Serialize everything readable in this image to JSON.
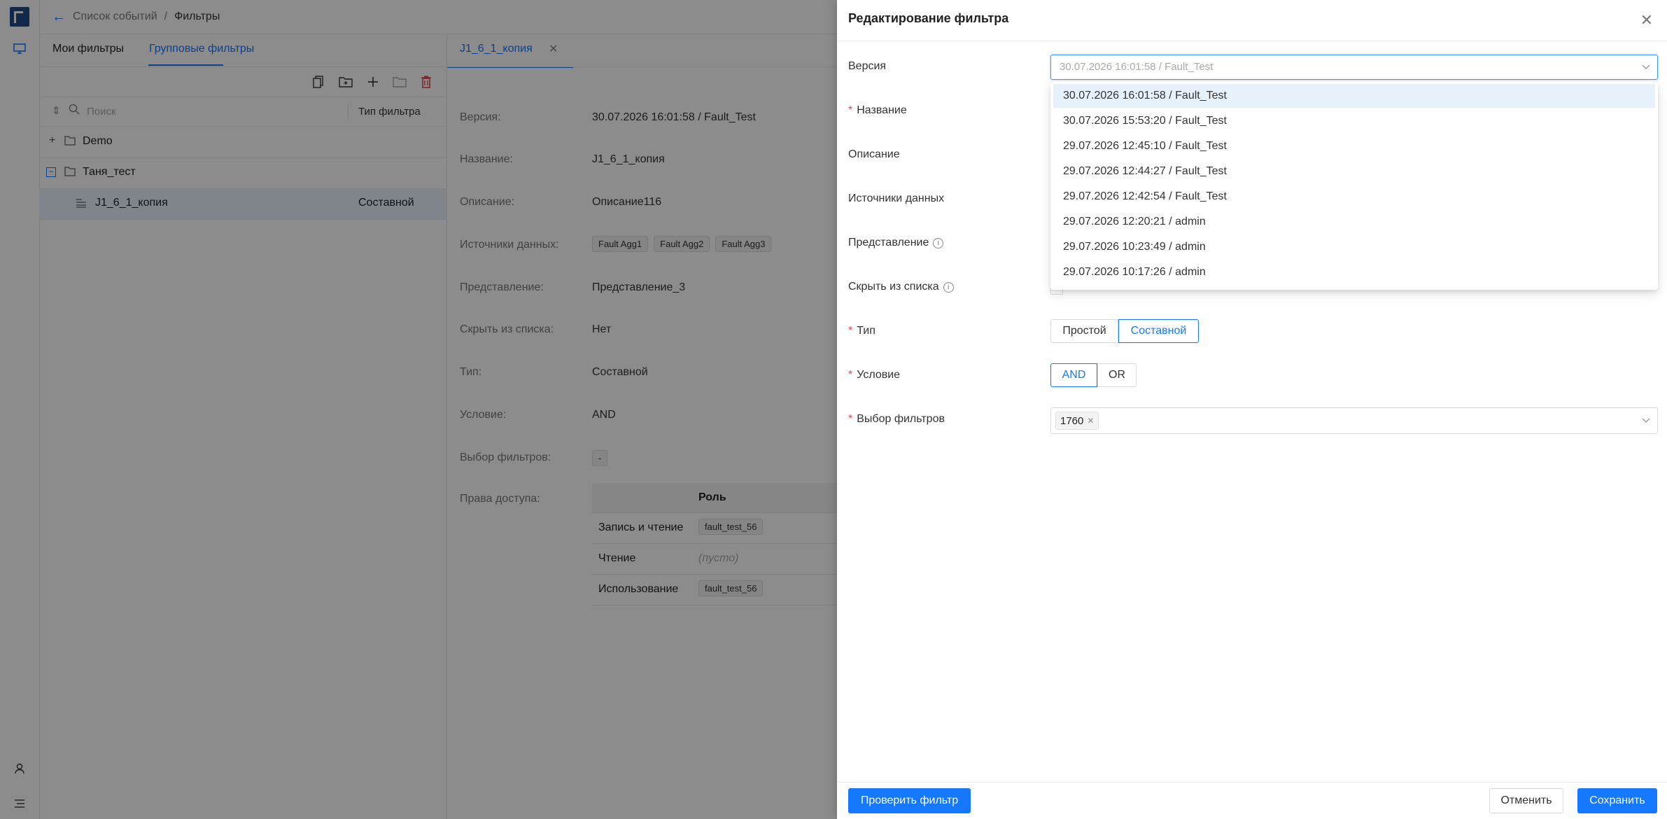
{
  "header": {
    "crumb_parent": "Список событий",
    "crumb_separator": "/",
    "crumb_current": "Фильтры"
  },
  "left_tabs": [
    "Мои фильтры",
    "Групповые фильтры"
  ],
  "tree": {
    "search_placeholder": "Поиск",
    "col_type": "Тип фильтра",
    "rows": [
      {
        "label": "Demo",
        "type": ""
      },
      {
        "label": "Таня_тест",
        "type": ""
      },
      {
        "label": "J1_6_1_копия",
        "type": "Составной"
      }
    ]
  },
  "detail": {
    "tab_label": "J1_6_1_копия",
    "fields": [
      {
        "label": "Версия:",
        "value": "30.07.2026 16:01:58 / Fault_Test"
      },
      {
        "label": "Название:",
        "value": "J1_6_1_копия"
      },
      {
        "label": "Описание:",
        "value": "Описание116"
      },
      {
        "label": "Источники данных:",
        "value": ""
      },
      {
        "label": "Представление:",
        "value": "Представление_3"
      },
      {
        "label": "Скрыть из списка:",
        "value": "Нет"
      },
      {
        "label": "Тип:",
        "value": "Составной"
      },
      {
        "label": "Условие:",
        "value": "AND"
      },
      {
        "label": "Выбор фильтров:",
        "value": "-"
      },
      {
        "label": "Права доступа:",
        "value": ""
      }
    ],
    "sources": [
      "Fault Agg1",
      "Fault Agg2",
      "Fault Agg3"
    ],
    "perm_header": "Роль",
    "perms": [
      {
        "right": "Запись и чтение",
        "role": "fault_test_56"
      },
      {
        "right": "Чтение",
        "role": "(пусто)"
      },
      {
        "right": "Использование",
        "role": "fault_test_56"
      }
    ]
  },
  "drawer": {
    "title": "Редактирование фильтра",
    "labels": {
      "version": "Версия",
      "name": "Название",
      "description": "Описание",
      "sources": "Источники данных",
      "view": "Представление",
      "hide": "Скрыть из списка",
      "type": "Тип",
      "condition": "Условие",
      "filters": "Выбор фильтров"
    },
    "version_placeholder": "30.07.2026 16:01:58 / Fault_Test",
    "version_options": [
      "30.07.2026 16:01:58 / Fault_Test",
      "30.07.2026 15:53:20 / Fault_Test",
      "29.07.2026 12:45:10 / Fault_Test",
      "29.07.2026 12:44:27 / Fault_Test",
      "29.07.2026 12:42:54 / Fault_Test",
      "29.07.2026 12:20:21 / admin",
      "29.07.2026 10:23:49 / admin",
      "29.07.2026 10:17:26 / admin"
    ],
    "type_options": [
      "Простой",
      "Составной"
    ],
    "type_selected": "Составной",
    "condition_options": [
      "AND",
      "OR"
    ],
    "condition_selected": "AND",
    "filters_tag": "1760",
    "buttons": {
      "check": "Проверить фильтр",
      "cancel": "Отменить",
      "save": "Сохранить"
    },
    "accent_color": "#1677ff"
  }
}
